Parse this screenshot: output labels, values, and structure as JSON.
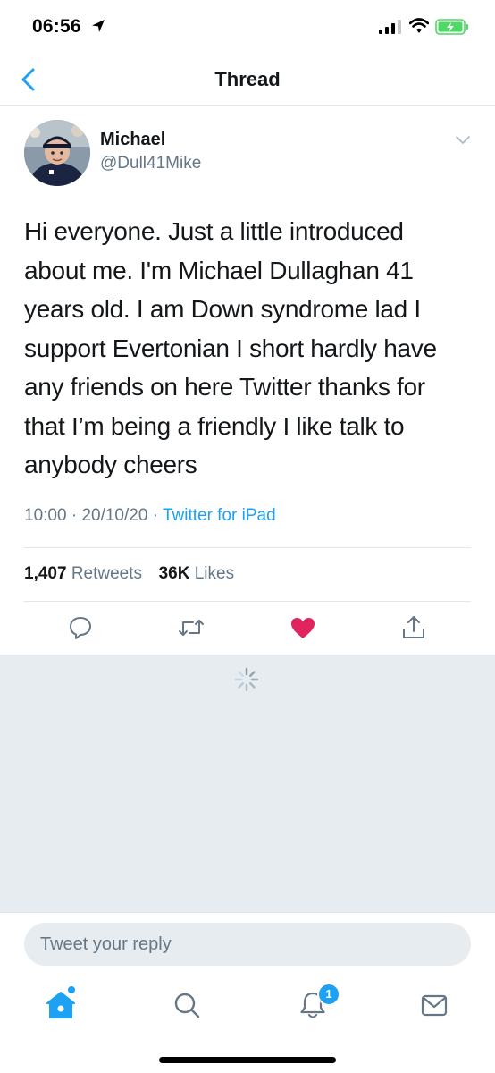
{
  "status_bar": {
    "time": "06:56"
  },
  "nav": {
    "title": "Thread"
  },
  "tweet": {
    "author_name": "Michael",
    "author_handle": "@Dull41Mike",
    "text_lines": [
      "Hi everyone. Just a little introduced",
      "about me. I'm Michael Dullaghan 41",
      "years old. I am Down syndrome lad I",
      "support Evertonian I short hardly have",
      "any friends on here Twitter thanks for",
      "that I’m being a friendly I like talk to",
      "anybody cheers"
    ],
    "time": "10:00",
    "date": "20/10/20",
    "source": "Twitter for iPad",
    "retweet_count": "1,407",
    "retweets_label": "Retweets",
    "like_count": "36K",
    "likes_label": "Likes",
    "liked": true
  },
  "reply": {
    "placeholder": "Tweet your reply"
  },
  "tabbar": {
    "notifications_badge": "1"
  },
  "colors": {
    "accent": "#1da1f2",
    "like": "#e0245e",
    "secondary_text": "#657786",
    "battery": "#4cd964"
  },
  "icons": [
    "location-arrow-icon",
    "signal-icon",
    "wifi-icon",
    "battery-icon",
    "back-chevron-icon",
    "chevron-down-icon",
    "reply-icon",
    "retweet-icon",
    "heart-icon",
    "share-icon",
    "loading-spinner-icon",
    "home-icon",
    "search-icon",
    "notifications-icon",
    "messages-icon"
  ]
}
